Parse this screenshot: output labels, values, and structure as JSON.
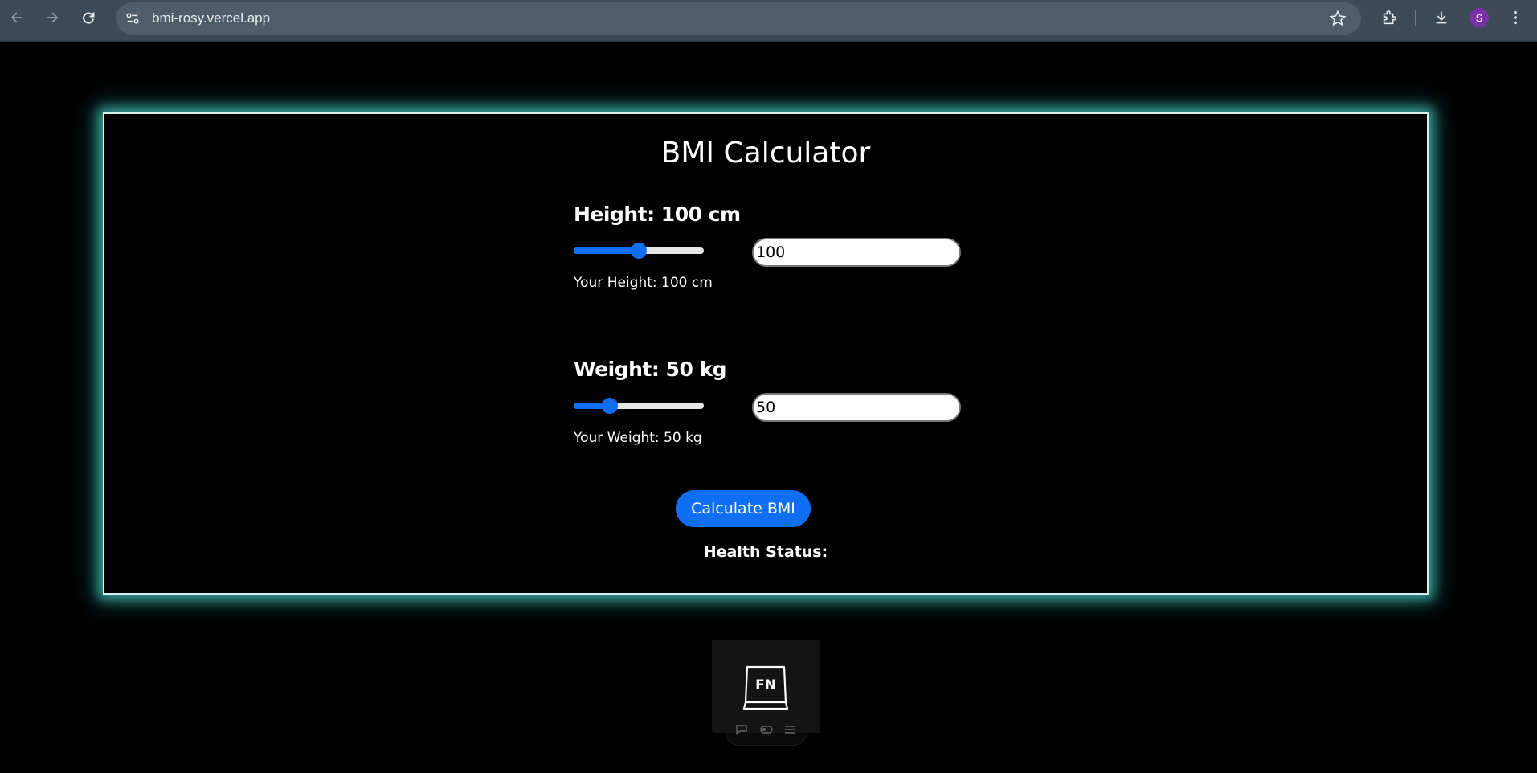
{
  "browser": {
    "url": "bmi-rosy.vercel.app",
    "profile_initial": "S",
    "icons": [
      "back-icon",
      "forward-icon",
      "reload-icon",
      "site-settings-icon",
      "star-icon",
      "extensions-icon",
      "download-icon",
      "menu-icon"
    ]
  },
  "app": {
    "title": "BMI Calculator",
    "height": {
      "label": "Height: 100 cm",
      "value": "100",
      "readout": "Your Height: 100 cm",
      "slider_fraction": 0.5
    },
    "weight": {
      "label": "Weight: 50 kg",
      "value": "50",
      "readout": "Your Weight: 50 kg",
      "slider_fraction": 0.28
    },
    "calculate_label": "Calculate BMI",
    "status_label": "Health Status:"
  },
  "widget": {
    "key_label": "FN",
    "icons": [
      "chat-icon",
      "toggle-icon",
      "menu-lines-icon"
    ]
  },
  "colors": {
    "accent": "#0f6ff2",
    "glow": "#46c8be",
    "background": "#000000"
  }
}
